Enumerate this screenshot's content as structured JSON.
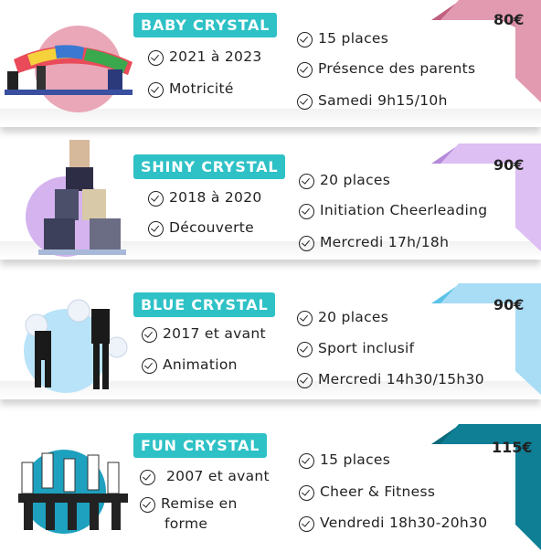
{
  "cards": [
    {
      "title": "BABY CRYSTAL",
      "price": "80€",
      "left_items": [
        "2021 à 2023",
        "Motricité"
      ],
      "right_items": [
        "15 places",
        "Présence des parents",
        "Samedi 9h15/10h"
      ],
      "colors": {
        "ribbon": "#d98aa3",
        "ribbon_dark": "#c0607f",
        "blob": "#e9a7b8"
      }
    },
    {
      "title": "SHINY CRYSTAL",
      "price": "90€",
      "left_items": [
        "2018 à 2020",
        "Découverte"
      ],
      "right_items": [
        "20 places",
        "Initiation Cheerleading",
        "Mercredi 17h/18h"
      ],
      "colors": {
        "ribbon": "#d9b6f0",
        "ribbon_dark": "#b38ad9",
        "blob": "#d4b3ef"
      }
    },
    {
      "title": "BLUE CRYSTAL",
      "price": "90€",
      "left_items": [
        "2017 et avant",
        "Animation"
      ],
      "right_items": [
        "20 places",
        "Sport inclusif",
        "Mercredi 14h30/15h30"
      ],
      "colors": {
        "ribbon": "#a9dcf5",
        "ribbon_dark": "#5cc3e8",
        "blob": "#b9e3f8"
      }
    },
    {
      "title": "FUN CRYSTAL",
      "price": "115€",
      "left_items": [
        "2007 et avant",
        "Remise en",
        "forme"
      ],
      "right_items": [
        "15 places",
        "Cheer & Fitness",
        "Vendredi 18h30-20h30"
      ],
      "colors": {
        "ribbon": "#0f7f95",
        "ribbon_dark": "#0a6a7d",
        "blob": "#1ea0bf"
      }
    }
  ],
  "accent_color": "#2ec1c6",
  "icons": {
    "item": "check-circle-icon"
  }
}
